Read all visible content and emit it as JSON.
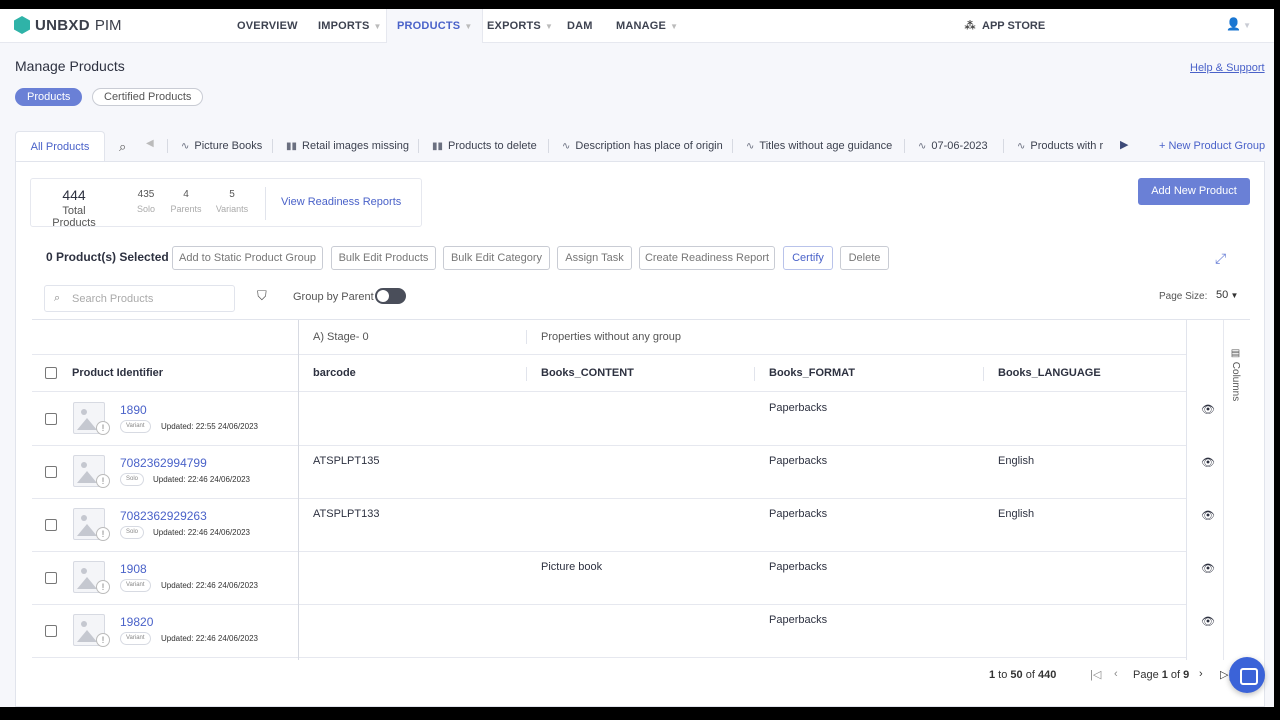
{
  "nav": {
    "brand": "UNBXD",
    "brand_sub": "PIM",
    "items": [
      {
        "label": "OVERVIEW"
      },
      {
        "label": "IMPORTS"
      },
      {
        "label": "PRODUCTS"
      },
      {
        "label": "EXPORTS"
      },
      {
        "label": "DAM"
      },
      {
        "label": "MANAGE"
      }
    ],
    "app_store": "APP STORE"
  },
  "header": {
    "title": "Manage Products",
    "help": "Help & Support",
    "pills": [
      "Products",
      "Certified Products"
    ]
  },
  "tabs": {
    "all": "All Products",
    "groups": [
      {
        "label": "Picture Books",
        "icon": "pulse-icon"
      },
      {
        "label": "Retail images missing",
        "icon": "bar-chart-icon"
      },
      {
        "label": "Products to delete",
        "icon": "bar-chart-icon"
      },
      {
        "label": "Description has place of origin",
        "icon": "pulse-icon"
      },
      {
        "label": "Titles without age guidance",
        "icon": "pulse-icon"
      },
      {
        "label": "07-06-2023",
        "icon": "pulse-icon"
      },
      {
        "label": "Products with r",
        "icon": "pulse-icon"
      }
    ],
    "new_group": "+ New Product Group"
  },
  "stats": {
    "total": "444",
    "total_label": "Total Products",
    "solo": "435",
    "solo_label": "Solo",
    "parents": "4",
    "parents_label": "Parents",
    "variants": "5",
    "variants_label": "Variants",
    "readiness": "View Readiness Reports"
  },
  "add_new": "Add New Product",
  "actions": {
    "selected": "0 Product(s) Selected",
    "buttons": [
      "Add to Static Product Group",
      "Bulk Edit Products",
      "Bulk Edit Category",
      "Assign Task",
      "Create Readiness Report",
      "Certify",
      "Delete"
    ]
  },
  "toolbar": {
    "search_placeholder": "Search Products",
    "group_by": "Group by Parent",
    "page_size_label": "Page Size:",
    "page_size": "50"
  },
  "table": {
    "groups": [
      "A) Stage- 0",
      "Properties without any group"
    ],
    "headers": [
      "Product Identifier",
      "barcode",
      "Books_CONTENT",
      "Books_FORMAT",
      "Books_LANGUAGE"
    ],
    "columns_label": "Columns",
    "rows": [
      {
        "id": "1890",
        "type": "Variant",
        "updated": "Updated: 22:55 24/06/2023",
        "barcode": "",
        "content": "",
        "format": "Paperbacks",
        "language": ""
      },
      {
        "id": "7082362994799",
        "type": "Solo",
        "updated": "Updated: 22:46 24/06/2023",
        "barcode": "ATSPLPT135",
        "content": "",
        "format": "Paperbacks",
        "language": "English"
      },
      {
        "id": "7082362929263",
        "type": "Solo",
        "updated": "Updated: 22:46 24/06/2023",
        "barcode": "ATSPLPT133",
        "content": "",
        "format": "Paperbacks",
        "language": "English"
      },
      {
        "id": "1908",
        "type": "Variant",
        "updated": "Updated: 22:46 24/06/2023",
        "barcode": "",
        "content": "Picture book",
        "format": "Paperbacks",
        "language": ""
      },
      {
        "id": "19820",
        "type": "Variant",
        "updated": "Updated: 22:46 24/06/2023",
        "barcode": "",
        "content": "",
        "format": "Paperbacks",
        "language": ""
      }
    ]
  },
  "pager": {
    "from": "1",
    "to": "50",
    "total": "440",
    "page": "1",
    "pages": "9"
  }
}
